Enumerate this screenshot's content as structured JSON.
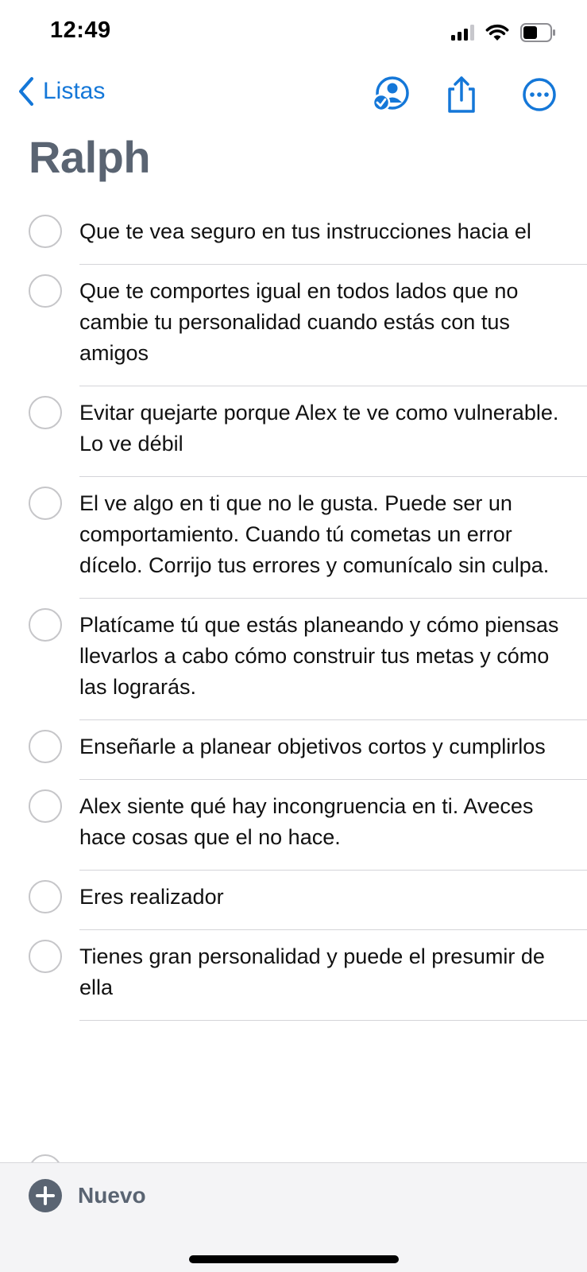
{
  "status_bar": {
    "time": "12:49",
    "icons": [
      "cellular-signal-icon",
      "wifi-icon",
      "battery-icon"
    ]
  },
  "nav": {
    "back_label": "Listas",
    "actions": [
      "share-person-icon",
      "share-icon",
      "more-icon"
    ]
  },
  "list": {
    "title": "Ralph",
    "items": [
      {
        "text": "Que te vea seguro en tus instrucciones hacia el"
      },
      {
        "text": "Que te comportes igual en todos lados que no cambie tu personalidad cuando estás con tus amigos"
      },
      {
        "text": "Evitar quejarte porque Alex te ve como vulnerable. Lo ve débil"
      },
      {
        "text": "El ve algo en ti que no le gusta. Puede ser un comportamiento. Cuando tú cometas un error dícelo. Corrijo tus errores y comunícalo sin culpa."
      },
      {
        "text": "Platícame tú que estás planeando y cómo piensas llevarlos a cabo cómo construir tus metas y cómo las lograrás."
      },
      {
        "text": "Enseñarle a planear objetivos cortos y cumplirlos"
      },
      {
        "text": "Alex siente qué hay incongruencia en ti. Aveces hace cosas que el no hace."
      },
      {
        "text": "Eres realizador"
      },
      {
        "text": "Tienes gran personalidad y puede el presumir de ella"
      }
    ]
  },
  "toolbar": {
    "new_label": "Nuevo"
  },
  "colors": {
    "accent": "#1477d8",
    "title": "#5a6472",
    "circle": "#c6c6c9"
  }
}
